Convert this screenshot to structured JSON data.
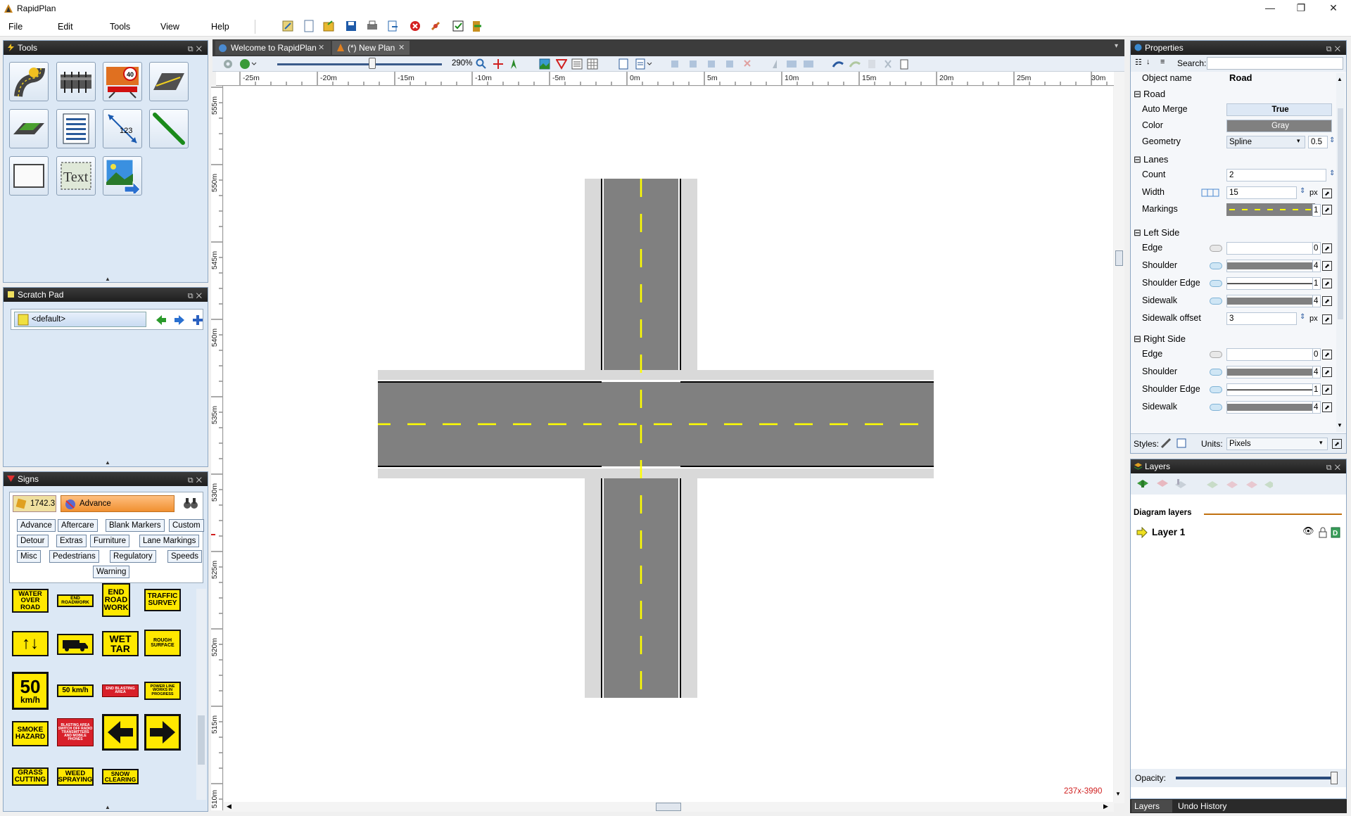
{
  "app": {
    "title": "RapidPlan"
  },
  "window": {
    "minimize": "—",
    "restore": "❐",
    "close": "✕"
  },
  "menu": [
    "File",
    "Edit",
    "Tools",
    "View",
    "Help"
  ],
  "tools_panel": {
    "title": "Tools"
  },
  "scratch_panel": {
    "title": "Scratch Pad",
    "selector": "<default>"
  },
  "signs_panel": {
    "title": "Signs",
    "code": "1742.3",
    "category": "Advance",
    "filters": [
      "Advance",
      "Aftercare",
      "Blank Markers",
      "Custom",
      "Detour",
      "Extras",
      "Furniture",
      "Lane Markings",
      "Misc",
      "Pedestrians",
      "Regulatory",
      "Speeds",
      "Warning"
    ],
    "signs": {
      "water": "WATER OVER ROAD",
      "end_roadwork": "END ROADWORK",
      "end_road_work": "END ROAD WORK",
      "traffic_survey": "TRAFFIC SURVEY",
      "wet_tar": "WET TAR",
      "rough_surface": "ROUGH SURFACE",
      "fifty_big": "50",
      "fifty_unit": "km/h",
      "fifty_small": "50 km/h",
      "end_blasting": "END BLASTING AREA",
      "power_line": "POWER LINE WORKS IN PROGRESS",
      "smoke": "SMOKE HAZARD",
      "blasting_area": "BLASTING AREA SWITCH OFF RADIO TRANSMITTERS AND MOBILE PHONES",
      "grass": "GRASS CUTTING",
      "weed": "WEED SPRAYING",
      "snow": "SNOW CLEARING"
    }
  },
  "tabs": [
    {
      "label": "Welcome to RapidPlan",
      "close": "✕"
    },
    {
      "label": "(*) New Plan",
      "close": "✕"
    }
  ],
  "canvas_toolbar": {
    "zoom": "290%"
  },
  "ruler_h": [
    "-25m",
    "-20m",
    "-15m",
    "-10m",
    "-5m",
    "0m",
    "5m",
    "10m",
    "15m",
    "20m",
    "25m",
    "30m"
  ],
  "ruler_v": [
    "555m",
    "550m",
    "545m",
    "540m",
    "535m",
    "530m",
    "525m",
    "520m",
    "515m",
    "510m"
  ],
  "canvas": {
    "coords": "237x-3990"
  },
  "properties": {
    "title": "Properties",
    "search_label": "Search:",
    "object_name_label": "Object name",
    "object_name": "Road",
    "sections": {
      "road": "Road",
      "lanes": "Lanes",
      "left": "Left Side",
      "right": "Right Side"
    },
    "auto_merge_label": "Auto Merge",
    "auto_merge": "True",
    "color_label": "Color",
    "color": "Gray",
    "geometry_label": "Geometry",
    "geometry": "Spline",
    "geometry_val": "0.5",
    "count_label": "Count",
    "count": "2",
    "width_label": "Width",
    "width": "15",
    "px": "px",
    "markings_label": "Markings",
    "markings_val": "1",
    "edge_label": "Edge",
    "edge_val": "0",
    "shoulder_label": "Shoulder",
    "shoulder_val": "4",
    "shoulder_edge_label": "Shoulder Edge",
    "shoulder_edge_val": "1",
    "sidewalk_label": "Sidewalk",
    "sidewalk_val": "4",
    "sidewalk_offset_label": "Sidewalk offset",
    "sidewalk_offset": "3",
    "r_edge_val": "0",
    "r_shoulder_val": "4",
    "r_shoulder_edge_val": "1",
    "r_sidewalk_val": "4",
    "styles_label": "Styles:",
    "units_label": "Units:",
    "units": "Pixels"
  },
  "layers_panel": {
    "title": "Layers",
    "diagram_layers": "Diagram layers",
    "layer": "Layer 1",
    "opacity_label": "Opacity:",
    "opacity": 1.0
  },
  "bottom_tabs": [
    "Layers",
    "Undo History"
  ],
  "colors": {
    "road": "#808080",
    "lane_marking": "#ffff00",
    "panel_bg": "#dce8f5",
    "header": "#2a2a2a",
    "accent": "#4a90d9"
  }
}
